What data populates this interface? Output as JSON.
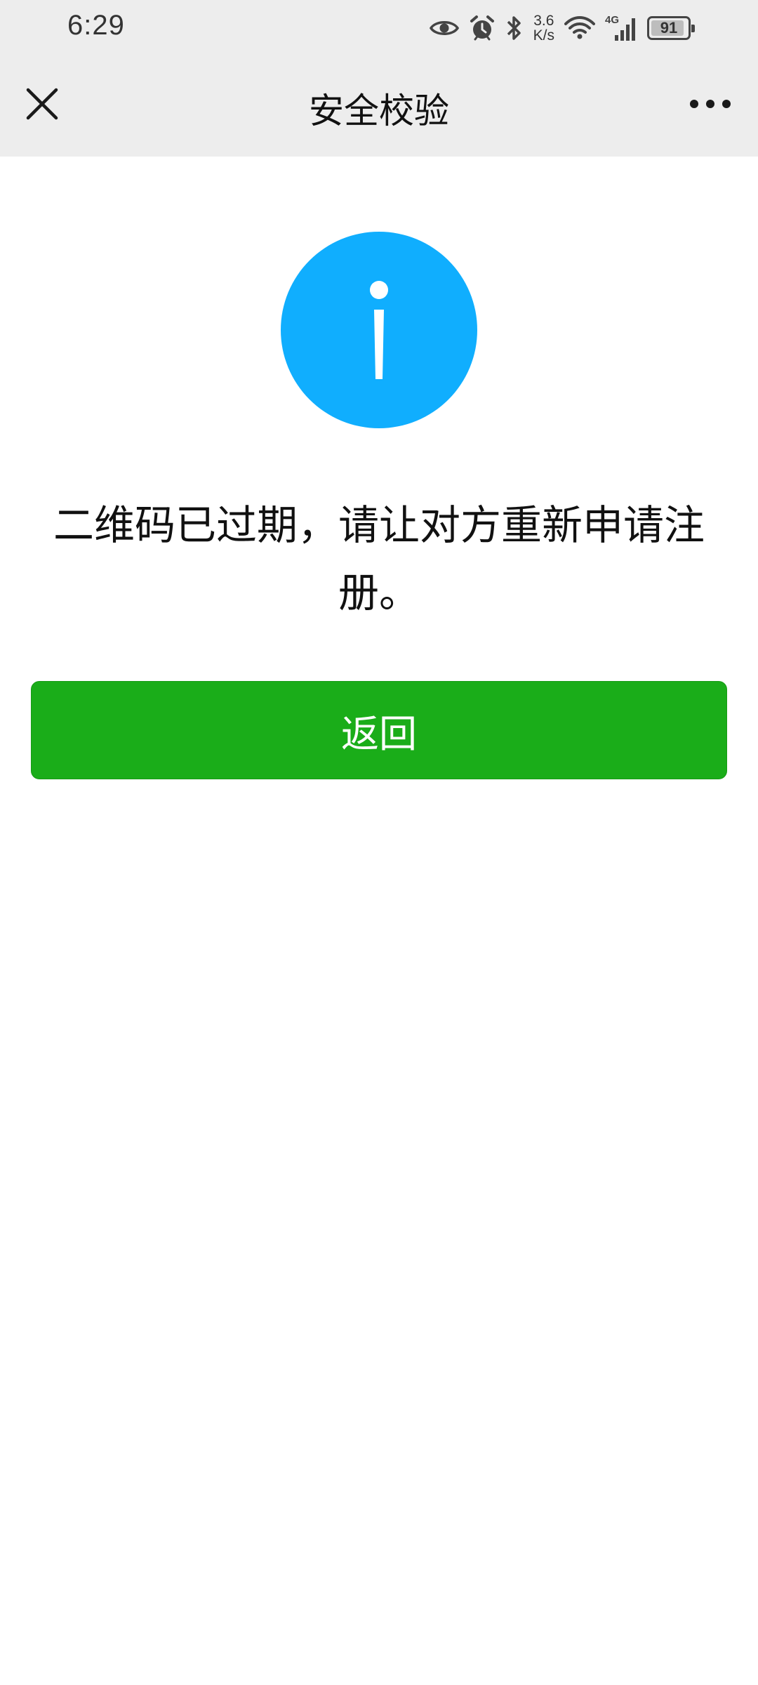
{
  "status_bar": {
    "time": "6:29",
    "net_speed_value": "3.6",
    "net_speed_unit": "K/s",
    "network_type": "4G",
    "battery_level": "91",
    "battery_fraction": 0.91,
    "icons": [
      "eye-icon",
      "alarm-icon",
      "bluetooth-icon",
      "wifi-icon",
      "signal-icon",
      "battery-icon"
    ]
  },
  "nav": {
    "title": "安全校验",
    "close_icon": "close-icon",
    "more_icon": "more-icon"
  },
  "content": {
    "icon": "info-icon",
    "icon_color": "#10aefe",
    "message": "二维码已过期，请让对方重新申请注册。",
    "button_label": "返回",
    "button_color": "#1aad19"
  }
}
